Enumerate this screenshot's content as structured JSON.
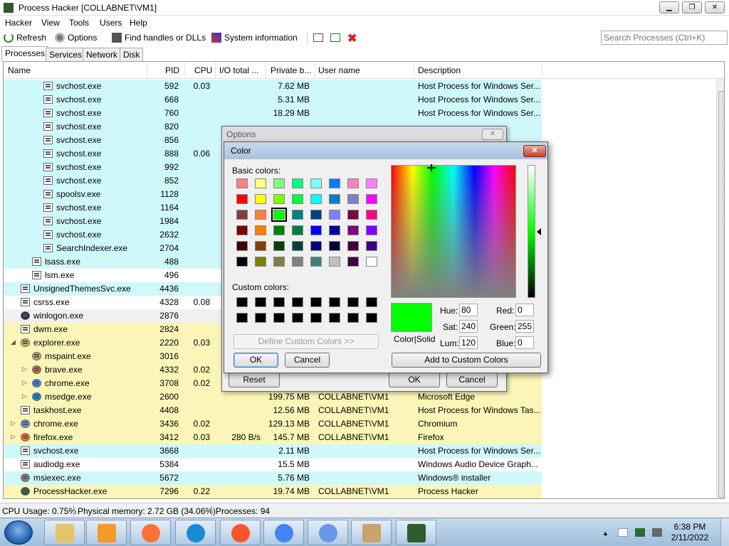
{
  "window": {
    "title": "Process Hacker [COLLABNET\\VM1]"
  },
  "menu": [
    "Hacker",
    "View",
    "Tools",
    "Users",
    "Help"
  ],
  "toolbar": {
    "refresh": "Refresh",
    "options": "Options",
    "find_handles": "Find handles or DLLs",
    "system_info": "System information",
    "search_placeholder": "Search Processes (Ctrl+K)"
  },
  "tabs": [
    "Processes",
    "Services",
    "Network",
    "Disk"
  ],
  "columns": [
    "Name",
    "PID",
    "CPU",
    "I/O total ...",
    "Private b...",
    "User name",
    "Description"
  ],
  "processes": [
    {
      "name": "svchost.exe",
      "pid": "592",
      "cpu": "0.03",
      "io": "",
      "private": "7.62 MB",
      "user": "",
      "desc": "Host Process for Windows Ser...",
      "indent": 3,
      "bg": "#cff8fb",
      "icon": "window-icon"
    },
    {
      "name": "svchost.exe",
      "pid": "668",
      "cpu": "",
      "io": "",
      "private": "5.31 MB",
      "user": "",
      "desc": "Host Process for Windows Ser...",
      "indent": 3,
      "bg": "#cff8fb",
      "icon": "window-icon"
    },
    {
      "name": "svchost.exe",
      "pid": "760",
      "cpu": "",
      "io": "",
      "private": "18.29 MB",
      "user": "",
      "desc": "Host Process for Windows Ser...",
      "indent": 3,
      "bg": "#cff8fb",
      "icon": "window-icon"
    },
    {
      "name": "svchost.exe",
      "pid": "820",
      "cpu": "",
      "io": "",
      "private": "",
      "user": "",
      "desc": "",
      "indent": 3,
      "bg": "#cff8fb",
      "icon": "window-icon"
    },
    {
      "name": "svchost.exe",
      "pid": "856",
      "cpu": "",
      "io": "",
      "private": "",
      "user": "",
      "desc": "",
      "indent": 3,
      "bg": "#cff8fb",
      "icon": "window-icon"
    },
    {
      "name": "svchost.exe",
      "pid": "888",
      "cpu": "0.06",
      "io": "",
      "private": "",
      "user": "",
      "desc": "",
      "indent": 3,
      "bg": "#cff8fb",
      "icon": "window-icon"
    },
    {
      "name": "svchost.exe",
      "pid": "992",
      "cpu": "",
      "io": "",
      "private": "",
      "user": "",
      "desc": "",
      "indent": 3,
      "bg": "#cff8fb",
      "icon": "window-icon"
    },
    {
      "name": "svchost.exe",
      "pid": "852",
      "cpu": "",
      "io": "",
      "private": "",
      "user": "",
      "desc": "",
      "indent": 3,
      "bg": "#cff8fb",
      "icon": "window-icon"
    },
    {
      "name": "spoolsv.exe",
      "pid": "1128",
      "cpu": "",
      "io": "",
      "private": "",
      "user": "",
      "desc": "",
      "indent": 3,
      "bg": "#cff8fb",
      "icon": "window-icon"
    },
    {
      "name": "svchost.exe",
      "pid": "1164",
      "cpu": "",
      "io": "",
      "private": "",
      "user": "",
      "desc": "",
      "indent": 3,
      "bg": "#cff8fb",
      "icon": "window-icon"
    },
    {
      "name": "svchost.exe",
      "pid": "1984",
      "cpu": "",
      "io": "",
      "private": "",
      "user": "",
      "desc": "",
      "indent": 3,
      "bg": "#cff8fb",
      "icon": "window-icon"
    },
    {
      "name": "svchost.exe",
      "pid": "2632",
      "cpu": "",
      "io": "",
      "private": "",
      "user": "",
      "desc": "",
      "indent": 3,
      "bg": "#cff8fb",
      "icon": "window-icon"
    },
    {
      "name": "SearchIndexer.exe",
      "pid": "2704",
      "cpu": "",
      "io": "",
      "private": "",
      "user": "",
      "desc": "",
      "indent": 3,
      "bg": "#cff8fb",
      "icon": "window-icon"
    },
    {
      "name": "lsass.exe",
      "pid": "488",
      "cpu": "",
      "io": "",
      "private": "",
      "user": "",
      "desc": "",
      "indent": 2,
      "bg": "#cff8fb",
      "icon": "window-icon"
    },
    {
      "name": "lsm.exe",
      "pid": "496",
      "cpu": "",
      "io": "",
      "private": "",
      "user": "",
      "desc": "",
      "indent": 2,
      "bg": "#ffffff",
      "icon": "window-icon"
    },
    {
      "name": "UnsignedThemesSvc.exe",
      "pid": "4436",
      "cpu": "",
      "io": "",
      "private": "",
      "user": "",
      "desc": "",
      "indent": 1,
      "bg": "#cff8fb",
      "icon": "window-icon"
    },
    {
      "name": "csrss.exe",
      "pid": "4328",
      "cpu": "0.08",
      "io": "",
      "private": "",
      "user": "",
      "desc": "",
      "indent": 1,
      "bg": "#ffffff",
      "icon": "window-icon"
    },
    {
      "name": "winlogon.exe",
      "pid": "2876",
      "cpu": "",
      "io": "",
      "private": "",
      "user": "",
      "desc": "",
      "indent": 1,
      "bg": "#f0f0f0",
      "icon": "winlogon-icon"
    },
    {
      "name": "dwm.exe",
      "pid": "2824",
      "cpu": "",
      "io": "",
      "private": "",
      "user": "",
      "desc": "",
      "indent": 1,
      "bg": "#fbf5b7",
      "icon": "window-icon"
    },
    {
      "name": "explorer.exe",
      "pid": "2220",
      "cpu": "0.03",
      "io": "",
      "private": "",
      "user": "",
      "desc": "",
      "indent": 1,
      "bg": "#fbf5b7",
      "icon": "explorer-icon",
      "expander": "◢"
    },
    {
      "name": "mspaint.exe",
      "pid": "3016",
      "cpu": "",
      "io": "",
      "private": "",
      "user": "",
      "desc": "",
      "indent": 2,
      "bg": "#fbf5b7",
      "icon": "paint-icon"
    },
    {
      "name": "brave.exe",
      "pid": "4332",
      "cpu": "0.02",
      "io": "",
      "private": "",
      "user": "",
      "desc": "",
      "indent": 2,
      "bg": "#fbf5b7",
      "icon": "brave-icon",
      "expander": "▷"
    },
    {
      "name": "chrome.exe",
      "pid": "3708",
      "cpu": "0.02",
      "io": "",
      "private": "",
      "user": "",
      "desc": "",
      "indent": 2,
      "bg": "#fbf5b7",
      "icon": "chrome-icon",
      "expander": "▷"
    },
    {
      "name": "msedge.exe",
      "pid": "2600",
      "cpu": "",
      "io": "",
      "private": "199.75 MB",
      "user": "COLLABNET\\VM1",
      "desc": "Microsoft Edge",
      "indent": 2,
      "bg": "#fbf5b7",
      "icon": "edge-icon",
      "expander": "▷"
    },
    {
      "name": "taskhost.exe",
      "pid": "4408",
      "cpu": "",
      "io": "",
      "private": "12.56 MB",
      "user": "COLLABNET\\VM1",
      "desc": "Host Process for Windows Tas...",
      "indent": 1,
      "bg": "#fbf5b7",
      "icon": "window-icon"
    },
    {
      "name": "chrome.exe",
      "pid": "3436",
      "cpu": "0.02",
      "io": "",
      "private": "129.13 MB",
      "user": "COLLABNET\\VM1",
      "desc": "Chromium",
      "indent": 1,
      "bg": "#fbf5b7",
      "icon": "chromium-icon",
      "expander": "▷"
    },
    {
      "name": "firefox.exe",
      "pid": "3412",
      "cpu": "0.03",
      "io": "280 B/s",
      "private": "145.7 MB",
      "user": "COLLABNET\\VM1",
      "desc": "Firefox",
      "indent": 1,
      "bg": "#fbf5b7",
      "icon": "firefox-icon",
      "expander": "▷"
    },
    {
      "name": "svchost.exe",
      "pid": "3668",
      "cpu": "",
      "io": "",
      "private": "2.11 MB",
      "user": "",
      "desc": "Host Process for Windows Ser...",
      "indent": 1,
      "bg": "#cff8fb",
      "icon": "window-icon"
    },
    {
      "name": "audiodg.exe",
      "pid": "5384",
      "cpu": "",
      "io": "",
      "private": "15.5 MB",
      "user": "",
      "desc": "Windows Audio Device Graph...",
      "indent": 1,
      "bg": "#ffffff",
      "icon": "window-icon"
    },
    {
      "name": "msiexec.exe",
      "pid": "5672",
      "cpu": "",
      "io": "",
      "private": "5.76 MB",
      "user": "",
      "desc": "Windows® installer",
      "indent": 1,
      "bg": "#cff8fb",
      "icon": "installer-icon"
    },
    {
      "name": "ProcessHacker.exe",
      "pid": "7296",
      "cpu": "0.22",
      "io": "",
      "private": "19.74 MB",
      "user": "COLLABNET\\VM1",
      "desc": "Process Hacker",
      "indent": 1,
      "bg": "#fbf5b7",
      "icon": "processhacker-icon"
    }
  ],
  "status": {
    "cpu": "CPU Usage: 0.75%",
    "memory": "Physical memory: 2.72 GB (34.06%)",
    "processes": "Processes: 94"
  },
  "options_dialog": {
    "title": "Options",
    "reset": "Reset",
    "ok": "OK",
    "cancel": "Cancel"
  },
  "color_dialog": {
    "title": "Color",
    "basic_colors_label": "Basic colors:",
    "custom_colors_label": "Custom colors:",
    "define_custom": "Define Custom Colors >>",
    "ok": "OK",
    "cancel": "Cancel",
    "add_custom": "Add to Custom Colors",
    "color_solid_label": "Color|Solid",
    "hue_label": "Hue:",
    "hue": "80",
    "sat_label": "Sat:",
    "sat": "240",
    "lum_label": "Lum:",
    "lum": "120",
    "red_label": "Red:",
    "red": "0",
    "green_label": "Green:",
    "green": "255",
    "blue_label": "Blue:",
    "blue": "0",
    "selected_color": "#00ff00",
    "basic_colors": [
      [
        "#ff8080",
        "#ffff80",
        "#80ff80",
        "#00ff80",
        "#80ffff",
        "#0080ff",
        "#ff80c0",
        "#ff80ff"
      ],
      [
        "#ff0000",
        "#ffff00",
        "#80ff00",
        "#00ff40",
        "#00ffff",
        "#0080c0",
        "#8080c0",
        "#ff00ff"
      ],
      [
        "#804040",
        "#ff8040",
        "#00ff00",
        "#008080",
        "#004080",
        "#8080ff",
        "#800040",
        "#ff0080"
      ],
      [
        "#800000",
        "#ff8000",
        "#008000",
        "#008040",
        "#0000ff",
        "#0000a0",
        "#800080",
        "#8000ff"
      ],
      [
        "#400000",
        "#804000",
        "#004000",
        "#004040",
        "#000080",
        "#000040",
        "#400040",
        "#400080"
      ],
      [
        "#000000",
        "#808000",
        "#808040",
        "#808080",
        "#408080",
        "#c0c0c0",
        "#400040",
        "#ffffff"
      ]
    ],
    "selected_swatch": [
      2,
      2
    ],
    "custom_colors": [
      [
        "#000000",
        "#000000",
        "#000000",
        "#000000",
        "#000000",
        "#000000",
        "#000000",
        "#000000"
      ],
      [
        "#000000",
        "#000000",
        "#000000",
        "#000000",
        "#000000",
        "#000000",
        "#000000",
        "#000000"
      ]
    ]
  },
  "taskbar": {
    "apps": [
      "explorer-icon",
      "media-player-icon",
      "firefox-icon",
      "edge-icon",
      "brave-icon",
      "chrome-icon",
      "chromium-icon",
      "paint-icon",
      "processhacker-icon"
    ],
    "time": "6:38 PM",
    "date": "2/11/2022"
  }
}
